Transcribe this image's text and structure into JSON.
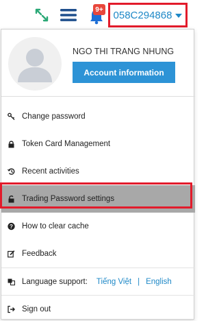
{
  "topbar": {
    "badge_count": "9+",
    "account_number": "058C294868"
  },
  "profile": {
    "name": "NGO THI TRANG NHUNG",
    "account_button": "Account information"
  },
  "menu": {
    "change_password": "Change password",
    "token_card": "Token Card Management",
    "recent_activities": "Recent activities",
    "trading_password": "Trading Password settings",
    "clear_cache": "How to clear cache",
    "feedback": "Feedback",
    "language_label": "Language support:",
    "lang_vi": "Tiếng Việt",
    "lang_sep": "|",
    "lang_en": "English",
    "sign_out": "Sign out"
  },
  "colors": {
    "accent_blue": "#1e88c7",
    "button_blue": "#2d93d6",
    "highlight_red": "#e21b2b",
    "active_gray": "#a8a8a8",
    "expand_green": "#2aa876",
    "nav_dark_blue": "#1f4f8c"
  },
  "icons": {
    "expand": "expand-arrows-icon",
    "menu": "hamburger-menu-icon",
    "bell": "bell-icon",
    "key": "key-icon",
    "lock": "lock-icon",
    "history": "history-icon",
    "unlock": "unlock-icon",
    "question": "question-circle-icon",
    "edit": "edit-icon",
    "language": "language-icon",
    "signout": "sign-out-icon"
  }
}
